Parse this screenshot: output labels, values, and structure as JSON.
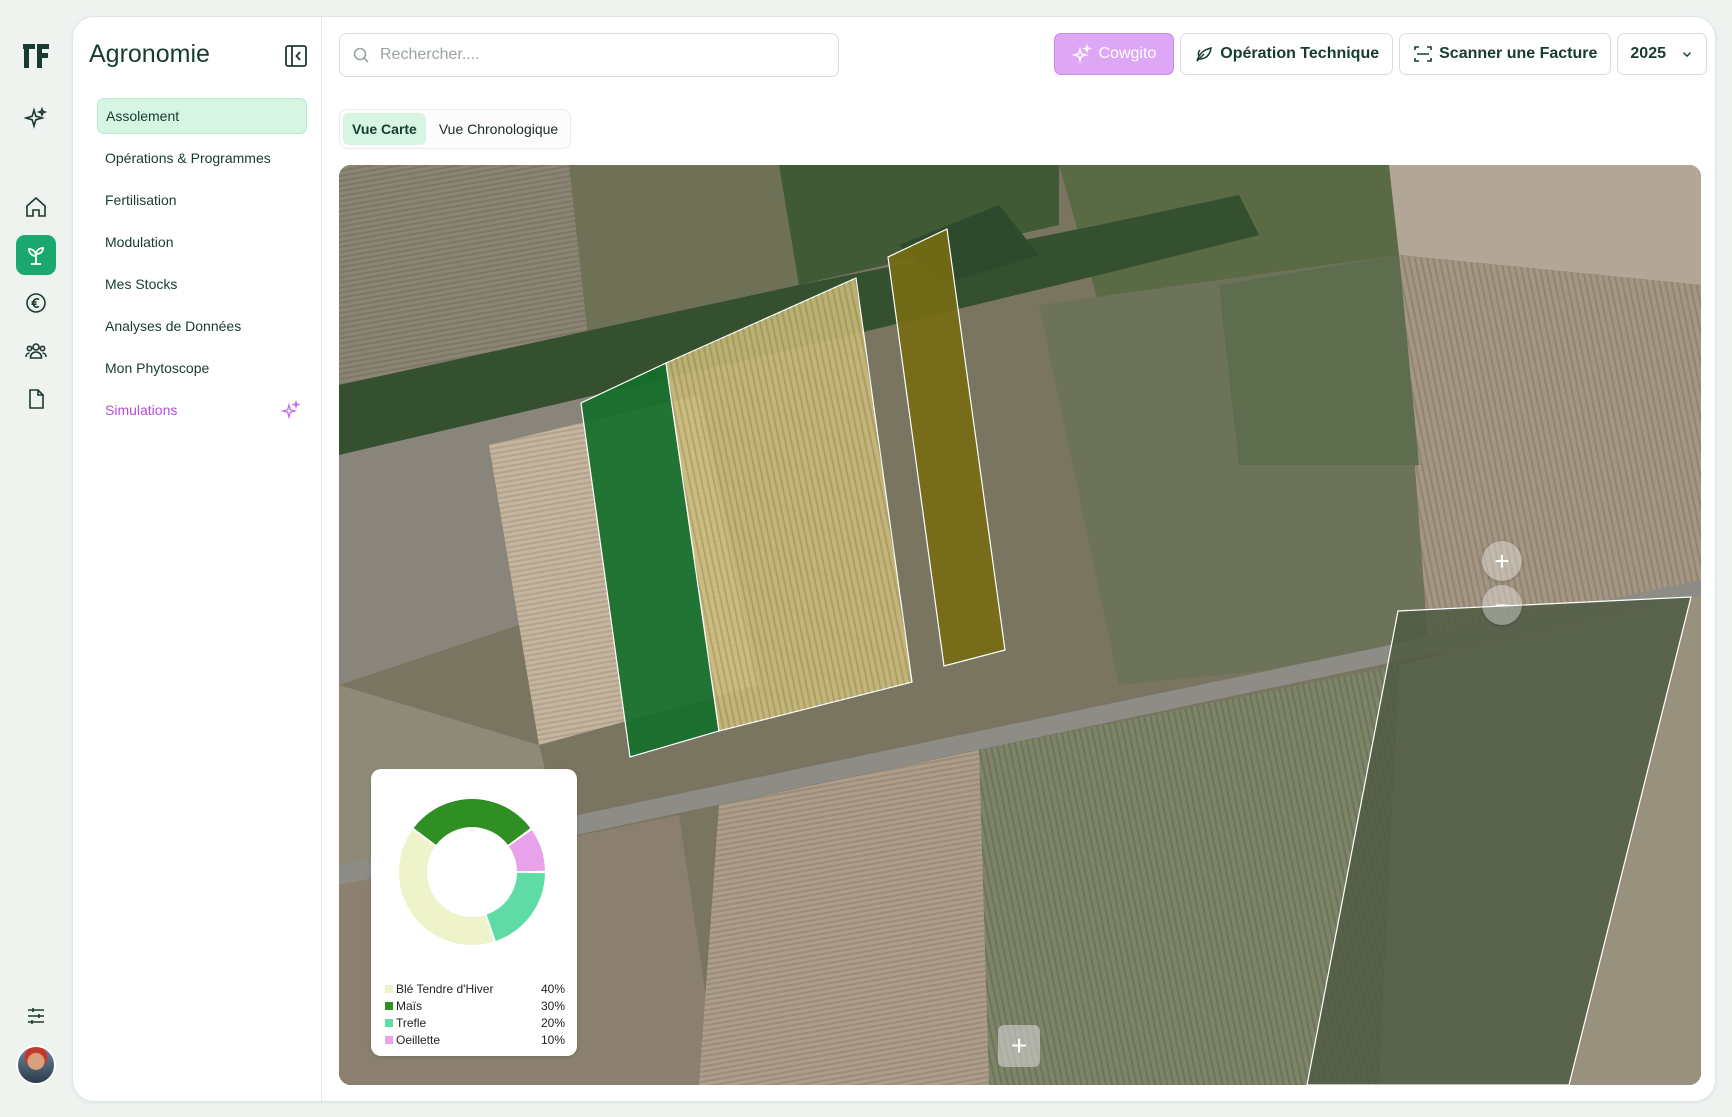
{
  "app": {
    "section_title": "Agronomie"
  },
  "sidebar": {
    "items": [
      {
        "label": "Assolement",
        "active": true
      },
      {
        "label": "Opérations & Programmes"
      },
      {
        "label": "Fertilisation"
      },
      {
        "label": "Modulation"
      },
      {
        "label": "Mes Stocks"
      },
      {
        "label": "Analyses de Données"
      },
      {
        "label": "Mon Phytoscope"
      },
      {
        "label": "Simulations",
        "highlight": true
      }
    ]
  },
  "rail": {
    "icons": [
      "logo-icon",
      "ai-sparkle-icon",
      "home-icon",
      "plant-icon",
      "euro-icon",
      "users-icon",
      "document-icon",
      "settings-sliders-icon",
      "avatar"
    ],
    "active": "plant-icon"
  },
  "search": {
    "placeholder": "Rechercher...."
  },
  "toolbar": {
    "ai_label": "Cowgito",
    "operation_label": "Opération Technique",
    "scan_label": "Scanner une Facture",
    "year": "2025"
  },
  "tabs": [
    {
      "label": "Vue Carte",
      "active": true
    },
    {
      "label": "Vue Chronologique"
    }
  ],
  "map": {
    "zoom_in": "+",
    "zoom_out": "−",
    "add_field": "+"
  },
  "legend": {
    "items": [
      {
        "name": "Blé Tendre d'Hiver",
        "pct": "40%",
        "value": 40,
        "color": "#eef3c9"
      },
      {
        "name": "Maïs",
        "pct": "30%",
        "value": 30,
        "color": "#2f8f23"
      },
      {
        "name": "Trefle",
        "pct": "20%",
        "value": 20,
        "color": "#5fdca6"
      },
      {
        "name": "Oeillette",
        "pct": "10%",
        "value": 10,
        "color": "#e7a2ea"
      }
    ]
  },
  "colors": {
    "accent": "#1aa86e",
    "ai": "#dda7f5",
    "active_bg": "#d6f5e3"
  }
}
